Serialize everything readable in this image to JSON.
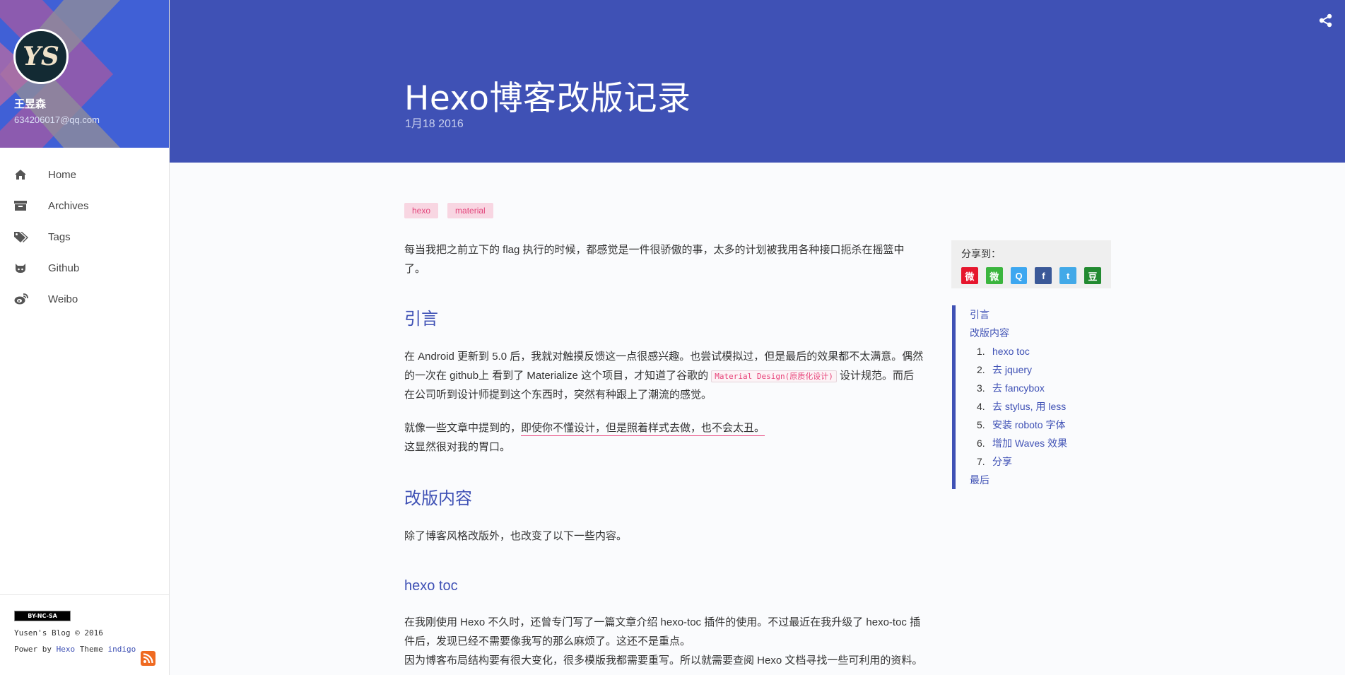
{
  "profile": {
    "avatar_text": "YS",
    "name": "王昱森",
    "email": "634206017@qq.com"
  },
  "nav": [
    {
      "label": "Home",
      "icon": "home-icon"
    },
    {
      "label": "Archives",
      "icon": "archive-icon"
    },
    {
      "label": "Tags",
      "icon": "tags-icon"
    },
    {
      "label": "Github",
      "icon": "github-icon"
    },
    {
      "label": "Weibo",
      "icon": "weibo-icon"
    }
  ],
  "footer": {
    "license": "BY-NC-SA",
    "copyright": "Yusen's Blog © 2016",
    "power_prefix": "Power by ",
    "power_hexo": "Hexo",
    "power_theme": " Theme ",
    "power_indigo": "indigo"
  },
  "post": {
    "title": "Hexo博客改版记录",
    "date": "1月18 2016",
    "tags": [
      "hexo",
      "material"
    ]
  },
  "article": {
    "intro": "每当我把之前立下的 flag 执行的时候，都感觉是一件很骄傲的事，太多的计划被我用各种接口扼杀在摇篮中了。",
    "h_intro": "引言",
    "p1_a": "在 Android 更新到 5.0 后，我就对触摸反馈这一点很感兴趣。也尝试模拟过，但是最后的效果都不太满意。偶然的一次在 github上 看到了 Materialize 这个项目，才知道了谷歌的 ",
    "p1_code": "Material Design(原质化设计)",
    "p1_b": " 设计规范。而后在公司听到设计师提到这个东西时，突然有种跟上了潮流的感觉。",
    "p2_a": "就像一些文章中提到的，",
    "p2_underline": "即使你不懂设计，但是照着样式去做，也不会太丑。",
    "p2_b": "这显然很对我的胃口。",
    "h_changes": "改版内容",
    "p3": "除了博客风格改版外，也改变了以下一些内容。",
    "h_toc": "hexo toc",
    "p4": "在我刚使用 Hexo 不久时，还曾专门写了一篇文章介绍 hexo-toc 插件的使用。不过最近在我升级了 hexo-toc 插件后，发现已经不需要像我写的那么麻烦了。这还不是重点。",
    "p5": "因为博客布局结构要有很大变化，很多模版我都需要重写。所以就需要查阅 Hexo 文档寻找一些可利用的资料。"
  },
  "share": {
    "label": "分享到：",
    "items": [
      {
        "name": "weibo",
        "color": "#e6162d",
        "glyph": "微"
      },
      {
        "name": "wechat",
        "color": "#3bb53e",
        "glyph": "微"
      },
      {
        "name": "qq",
        "color": "#3da7f0",
        "glyph": "Q"
      },
      {
        "name": "facebook",
        "color": "#3b5998",
        "glyph": "f"
      },
      {
        "name": "twitter",
        "color": "#42a9e8",
        "glyph": "t"
      },
      {
        "name": "douban",
        "color": "#228a31",
        "glyph": "豆"
      }
    ]
  },
  "toc": {
    "top1": "引言",
    "top2": "改版内容",
    "sub": [
      {
        "num": "1.",
        "label": "hexo toc"
      },
      {
        "num": "2.",
        "label": "去 jquery"
      },
      {
        "num": "3.",
        "label": "去 fancybox"
      },
      {
        "num": "4.",
        "label": "去 stylus, 用 less"
      },
      {
        "num": "5.",
        "label": "安装 roboto 字体"
      },
      {
        "num": "6.",
        "label": "增加 Waves 效果"
      },
      {
        "num": "7.",
        "label": "分享"
      }
    ],
    "top3": "最后"
  },
  "colors": {
    "primary": "#3f51b5",
    "accent": "#e94b81"
  }
}
